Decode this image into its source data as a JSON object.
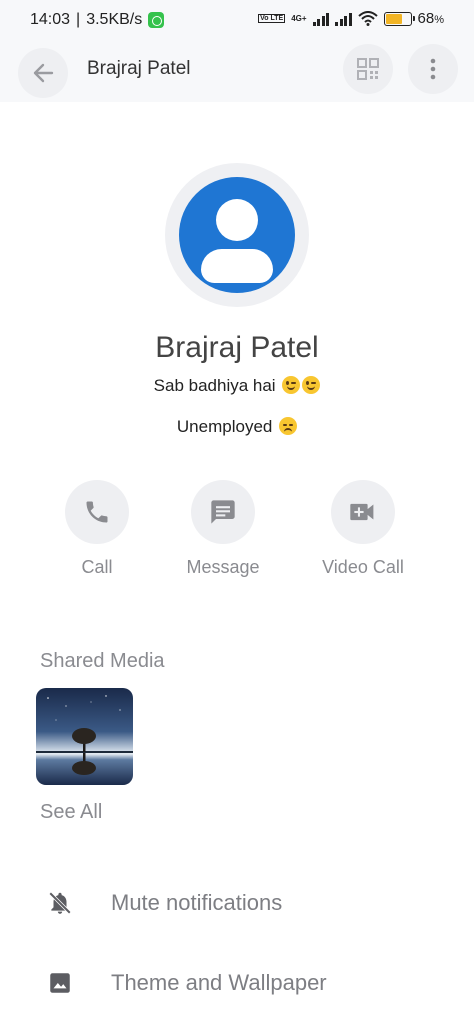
{
  "status_bar": {
    "time": "14:03",
    "speed": "3.5KB/s",
    "network": "4G+",
    "volte": "Vo LTE",
    "battery_percent": "68",
    "battery_unit": "%",
    "battery_level": 0.68
  },
  "header": {
    "title": "Brajraj Patel"
  },
  "profile": {
    "name": "Brajraj Patel",
    "status": "Sab badhiya hai",
    "about": "Unemployed"
  },
  "actions": {
    "call": "Call",
    "message": "Message",
    "video_call": "Video Call"
  },
  "shared_media": {
    "title": "Shared Media",
    "see_all": "See All"
  },
  "settings": {
    "mute": "Mute notifications",
    "theme": "Theme and Wallpaper"
  },
  "colors": {
    "accent": "#1f76d3",
    "icon_gray": "#8a8b90",
    "circle_bg": "#eeeff2"
  }
}
